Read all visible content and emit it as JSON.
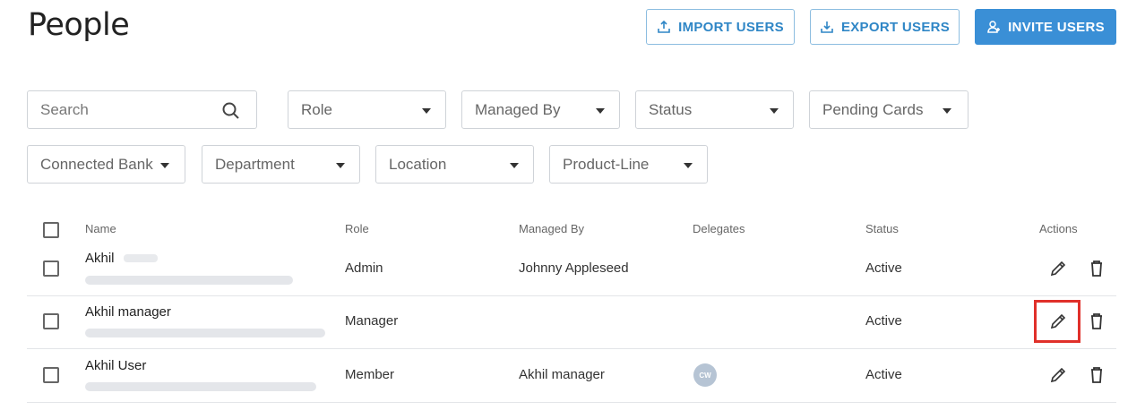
{
  "page": {
    "title": "People"
  },
  "header_actions": {
    "import_label": "IMPORT USERS",
    "export_label": "EXPORT USERS",
    "invite_label": "INVITE USERS"
  },
  "filters": {
    "search_placeholder": "Search",
    "role": "Role",
    "managed_by": "Managed By",
    "status": "Status",
    "pending_cards": "Pending Cards",
    "connected_bank": "Connected Bank",
    "department": "Department",
    "location": "Location",
    "product_line": "Product-Line"
  },
  "table": {
    "columns": {
      "name": "Name",
      "role": "Role",
      "managed_by": "Managed By",
      "delegates": "Delegates",
      "status": "Status",
      "actions": "Actions"
    },
    "rows": [
      {
        "name": "Akhil",
        "role": "Admin",
        "managed_by": "Johnny Appleseed",
        "delegate": "",
        "status": "Active"
      },
      {
        "name": "Akhil manager",
        "role": "Manager",
        "managed_by": "",
        "delegate": "",
        "status": "Active"
      },
      {
        "name": "Akhil User",
        "role": "Member",
        "managed_by": "Akhil manager",
        "delegate": "CW",
        "status": "Active"
      }
    ]
  },
  "colors": {
    "accent": "#3a8fd6",
    "highlight": "#e0302a"
  }
}
